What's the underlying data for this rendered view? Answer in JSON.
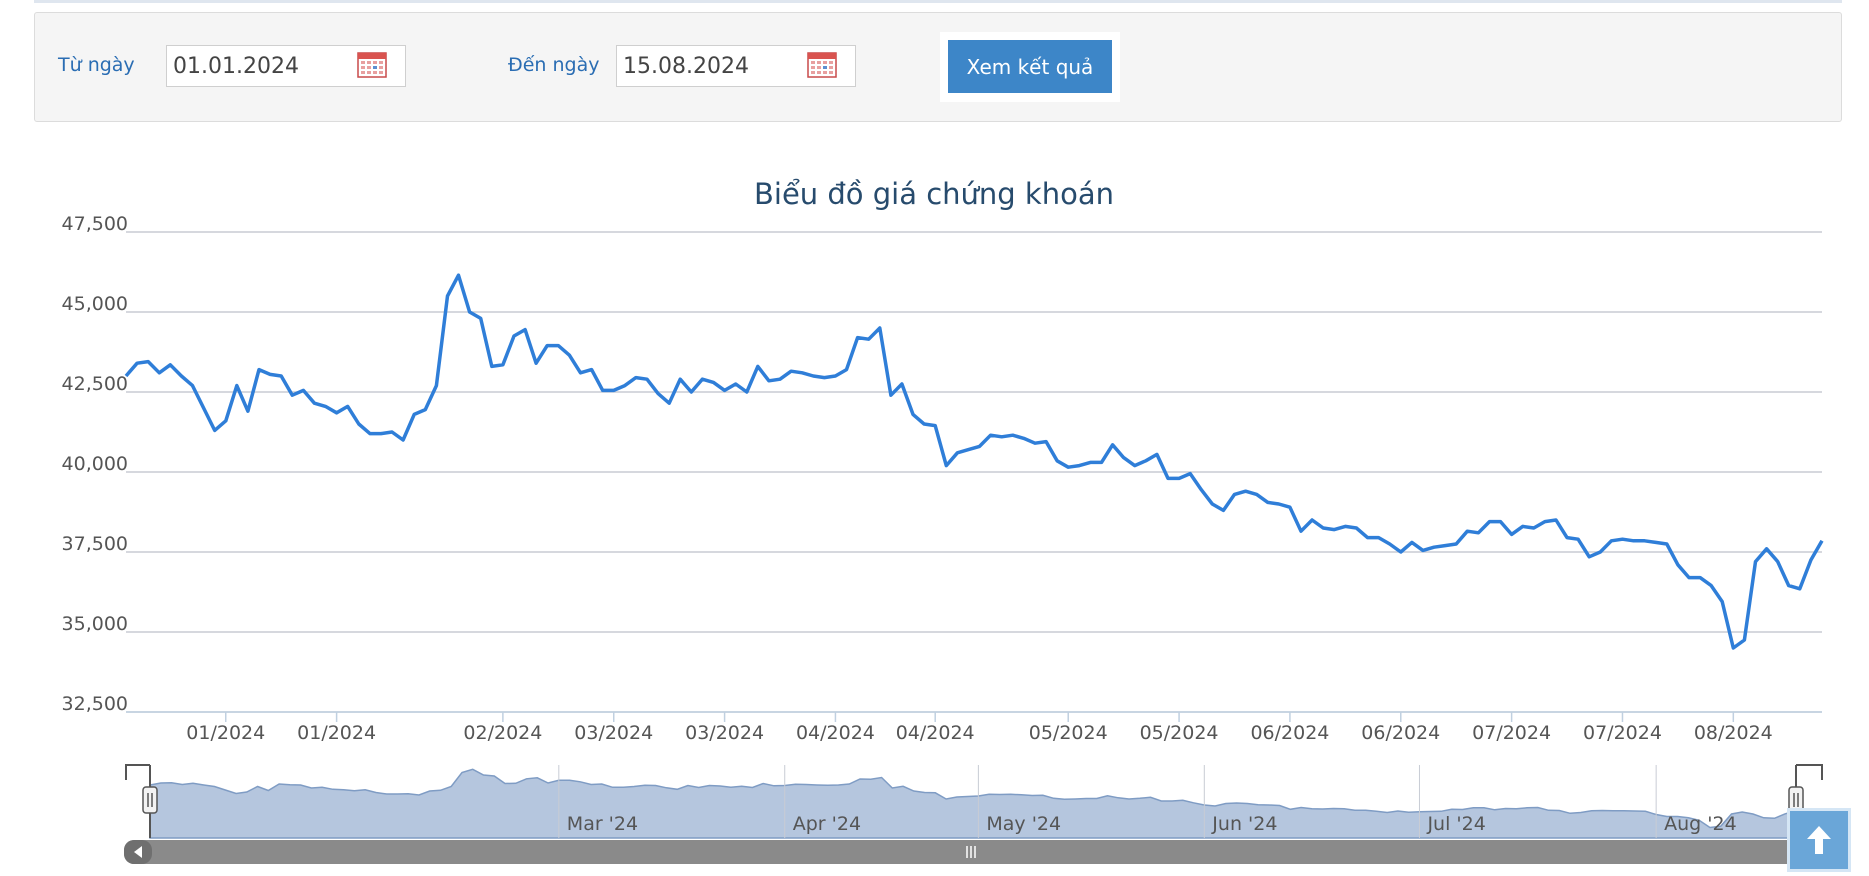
{
  "filter": {
    "from_label": "Từ ngày",
    "from_value": "01.01.2024",
    "to_label": "Đến ngày",
    "to_value": "15.08.2024",
    "submit_label": "Xem kết quả",
    "calendar_icon": "calendar-icon"
  },
  "colors": {
    "accent": "#3d86c8",
    "line": "#2f7ed8",
    "navigator_fill": "#b5c6de",
    "scrollbar": "#8a8a8a"
  },
  "chart_data": {
    "type": "line",
    "title": "Biểu đồ giá chứng khoán",
    "xlabel": "",
    "ylabel": "",
    "ylim": [
      32500,
      47500
    ],
    "yticks": [
      "47,500",
      "45,000",
      "42,500",
      "40,000",
      "37,500",
      "35,000",
      "32,500"
    ],
    "yticks_values": [
      47500,
      45000,
      42500,
      40000,
      37500,
      35000,
      32500
    ],
    "xticks": [
      "01/2024",
      "01/2024",
      "02/2024",
      "03/2024",
      "03/2024",
      "04/2024",
      "04/2024",
      "05/2024",
      "05/2024",
      "06/2024",
      "06/2024",
      "07/2024",
      "07/2024",
      "08/2024"
    ],
    "xticks_index": [
      9,
      19,
      34,
      44,
      54,
      64,
      73,
      85,
      95,
      105,
      115,
      125,
      135,
      145
    ],
    "grid": true,
    "legend": "none",
    "series": [
      {
        "values": [
          43000,
          43400,
          43450,
          43100,
          43350,
          43000,
          42700,
          42000,
          41300,
          41600,
          42700,
          41900,
          43200,
          43050,
          43000,
          42400,
          42550,
          42150,
          42050,
          41850,
          42050,
          41500,
          41200,
          41200,
          41250,
          41000,
          41800,
          41950,
          42700,
          45500,
          46150,
          45000,
          44800,
          43300,
          43350,
          44250,
          44450,
          43400,
          43950,
          43950,
          43650,
          43100,
          43200,
          42550,
          42550,
          42700,
          42950,
          42900,
          42450,
          42150,
          42900,
          42500,
          42900,
          42800,
          42550,
          42750,
          42500,
          43300,
          42850,
          42900,
          43150,
          43100,
          43000,
          42950,
          43000,
          43200,
          44200,
          44150,
          44500,
          42400,
          42750,
          41800,
          41500,
          41450,
          40200,
          40600,
          40700,
          40800,
          41150,
          41100,
          41150,
          41050,
          40900,
          40950,
          40350,
          40150,
          40200,
          40300,
          40300,
          40850,
          40450,
          40200,
          40350,
          40550,
          39800,
          39800,
          39950,
          39450,
          39000,
          38800,
          39300,
          39400,
          39300,
          39050,
          39000,
          38900,
          38150,
          38500,
          38250,
          38200,
          38300,
          38250,
          37950,
          37950,
          37750,
          37500,
          37800,
          37550,
          37650,
          37700,
          37750,
          38150,
          38100,
          38450,
          38450,
          38050,
          38300,
          38250,
          38450,
          38500,
          37950,
          37900,
          37350,
          37500,
          37850,
          37900,
          37850,
          37850,
          37800,
          37750,
          37100,
          36700,
          36700,
          36450,
          35950,
          34500,
          34750,
          37200,
          37600,
          37200,
          36450,
          36350,
          37250,
          37850
        ]
      }
    ],
    "navigator": {
      "labels": [
        "Mar '24",
        "Apr '24",
        "May '24",
        "Jun '24",
        "Jul '24",
        "Aug '24"
      ],
      "labels_index": [
        38,
        59,
        77,
        98,
        118,
        140
      ]
    }
  }
}
